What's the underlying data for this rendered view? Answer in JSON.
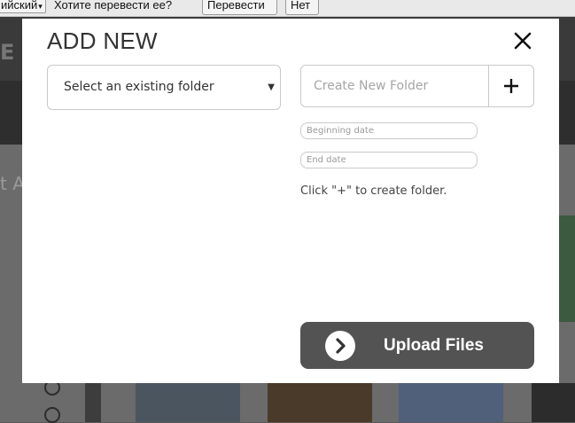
{
  "translate_bar": {
    "language": "ийский",
    "question": "Хотите перевести ее?",
    "translate_button": "Перевести",
    "no_button": "Нет"
  },
  "background": {
    "logo_text": "E",
    "partial_text": "t A"
  },
  "modal": {
    "title": "ADD NEW",
    "select_folder": {
      "selected": "Select an existing folder"
    },
    "new_folder": {
      "placeholder": "Create New Folder",
      "add_icon": "plus-icon"
    },
    "beginning_date": {
      "placeholder": "Beginning date"
    },
    "end_date": {
      "placeholder": "End date"
    },
    "hint": "Click \"+\" to create folder.",
    "upload": {
      "label": "Upload Files",
      "icon": "chevron-right-circle-icon"
    },
    "close_icon": "close-icon"
  },
  "colors": {
    "upload_button": "#535353",
    "overlay": "#5a5a5a",
    "modal_bg": "#ffffff"
  }
}
